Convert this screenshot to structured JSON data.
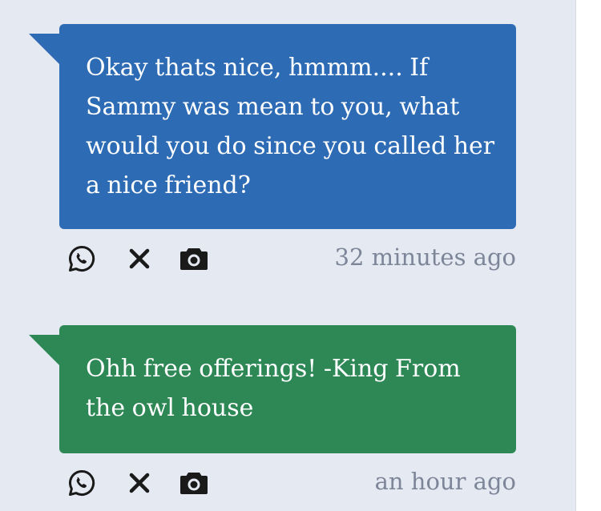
{
  "messages": [
    {
      "text": "Okay thats nice, hmmm.... If Sammy was mean to you, what would you do since you called her a nice friend?",
      "timestamp": "32 minutes ago",
      "bubble_color": "#2d6bb5"
    },
    {
      "text": "Ohh free offerings! -King From the owl house",
      "timestamp": "an hour ago",
      "bubble_color": "#2e8856"
    }
  ],
  "icons": {
    "share_whatsapp": "whatsapp-icon",
    "share_x": "x-icon",
    "screenshot": "camera-icon"
  },
  "colors": {
    "page_background": "#e5e9f1",
    "timestamp": "#7d8699",
    "icon": "#1a1a1a"
  }
}
